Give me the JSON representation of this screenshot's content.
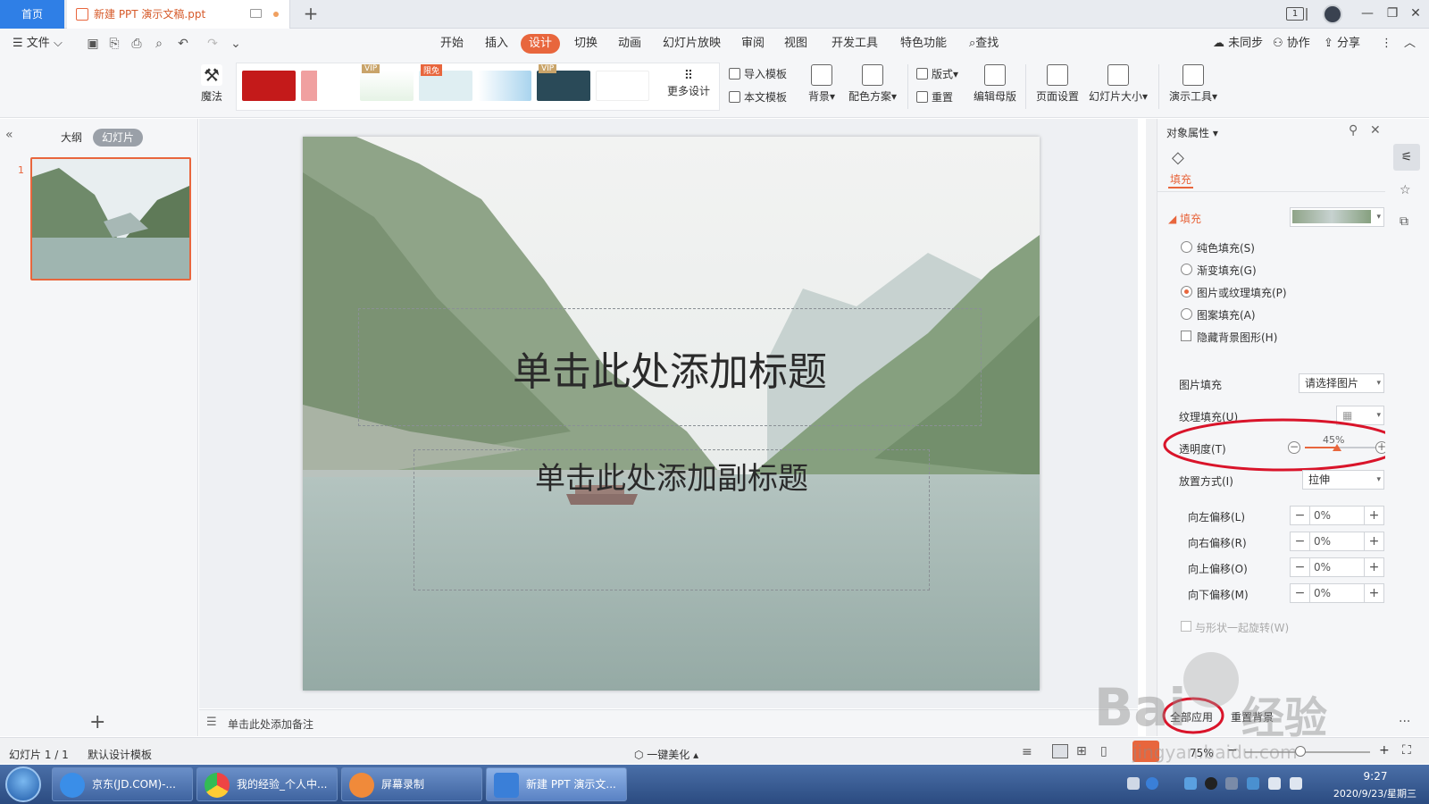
{
  "tabs": {
    "home": "首页",
    "doc": "新建 PPT 演示文稿.ppt"
  },
  "window": {
    "badge": "1"
  },
  "menu": {
    "file": "文件",
    "items": [
      "开始",
      "插入",
      "设计",
      "切换",
      "动画",
      "幻灯片放映",
      "审阅",
      "视图",
      "开发工具",
      "特色功能"
    ],
    "active": "设计",
    "search": "查找",
    "unsync": "未同步",
    "collab": "协作",
    "share": "分享"
  },
  "ribbon": {
    "magic": "魔法",
    "more_designs": "更多设计",
    "import_template": "导入模板",
    "text_template": "本文模板",
    "background": "背景",
    "color_scheme": "配色方案",
    "layout": "版式",
    "reset": "重置",
    "edit_master": "编辑母版",
    "page_setup": "页面设置",
    "slide_size": "幻灯片大小",
    "present_tools": "演示工具",
    "vip": "VIP",
    "limited": "限免"
  },
  "left_panel": {
    "outline": "大纲",
    "slides": "幻灯片",
    "slide_number": "1"
  },
  "slide": {
    "title": "单击此处添加标题",
    "subtitle": "单击此处添加副标题"
  },
  "notes": {
    "placeholder": "单击此处添加备注"
  },
  "right_panel": {
    "header": "对象属性",
    "tab_fill": "填充",
    "section_fill": "填充",
    "options": [
      "纯色填充(S)",
      "渐变填充(G)",
      "图片或纹理填充(P)",
      "图案填充(A)"
    ],
    "selected_option": 2,
    "hide_bg": "隐藏背景图形(H)",
    "picture_fill_label": "图片填充",
    "picture_fill_value": "请选择图片",
    "texture_fill_label": "纹理填充(U)",
    "transparency_label": "透明度(T)",
    "transparency_value": "45%",
    "transparency_level": 0.45,
    "placement_label": "放置方式(I)",
    "placement_value": "拉伸",
    "offsets": [
      {
        "label": "向左偏移(L)",
        "value": "0%"
      },
      {
        "label": "向右偏移(R)",
        "value": "0%"
      },
      {
        "label": "向上偏移(O)",
        "value": "0%"
      },
      {
        "label": "向下偏移(M)",
        "value": "0%"
      }
    ],
    "rotate_with_shape": "与形状一起旋转(W)",
    "apply_all": "全部应用",
    "reset_bg": "重置背景"
  },
  "status": {
    "slide_info": "幻灯片 1 / 1",
    "template": "默认设计模板",
    "beautify": "一键美化",
    "zoom": "75%"
  },
  "taskbar": {
    "items": [
      "京东(JD.COM)-...",
      "我的经验_个人中...",
      "屏幕录制",
      "新建 PPT 演示文..."
    ],
    "time": "9:27",
    "date": "2020/9/23/星期三"
  },
  "watermark": {
    "brand": "Bai",
    "brand2": "经验",
    "url": "jingyan.baidu.com"
  },
  "colors": {
    "accent": "#e8663d",
    "home_tab": "#2f7fe6",
    "annotation": "#d9142a"
  }
}
